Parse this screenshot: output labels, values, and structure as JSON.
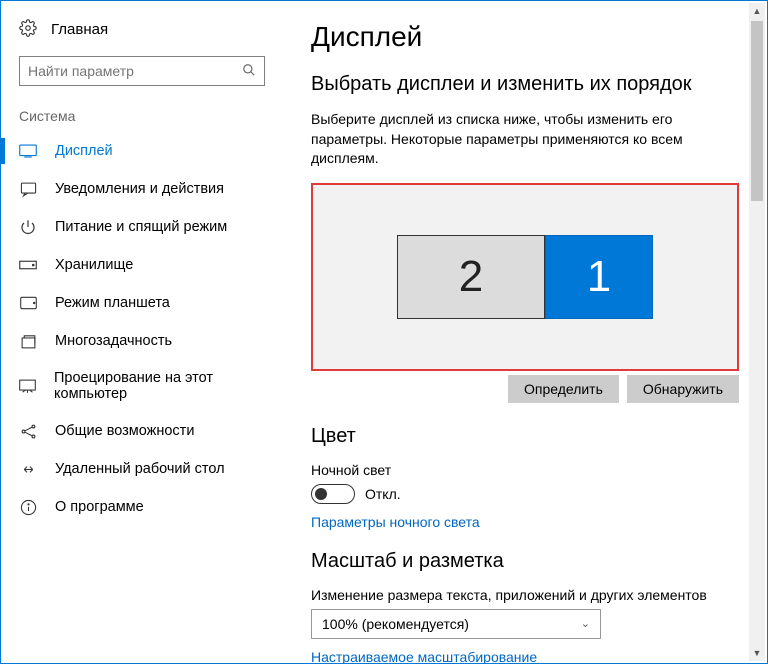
{
  "sidebar": {
    "home_label": "Главная",
    "search_placeholder": "Найти параметр",
    "group_title": "Система",
    "items": [
      {
        "label": "Дисплей"
      },
      {
        "label": "Уведомления и действия"
      },
      {
        "label": "Питание и спящий режим"
      },
      {
        "label": "Хранилище"
      },
      {
        "label": "Режим планшета"
      },
      {
        "label": "Многозадачность"
      },
      {
        "label": "Проецирование на этот компьютер"
      },
      {
        "label": "Общие возможности"
      },
      {
        "label": "Удаленный рабочий стол"
      },
      {
        "label": "О программе"
      }
    ]
  },
  "main": {
    "title": "Дисплей",
    "select_title": "Выбрать дисплеи и изменить их порядок",
    "select_desc": "Выберите дисплей из списка ниже, чтобы изменить его параметры. Некоторые параметры применяются ко всем дисплеям.",
    "monitor2_label": "2",
    "monitor1_label": "1",
    "identify_btn": "Определить",
    "detect_btn": "Обнаружить",
    "color_title": "Цвет",
    "night_light_label": "Ночной свет",
    "toggle_state": "Откл.",
    "night_light_link": "Параметры ночного света",
    "scale_title": "Масштаб и разметка",
    "scale_desc": "Изменение размера текста, приложений и других элементов",
    "scale_value": "100% (рекомендуется)",
    "custom_scale_link": "Настраиваемое масштабирование"
  }
}
